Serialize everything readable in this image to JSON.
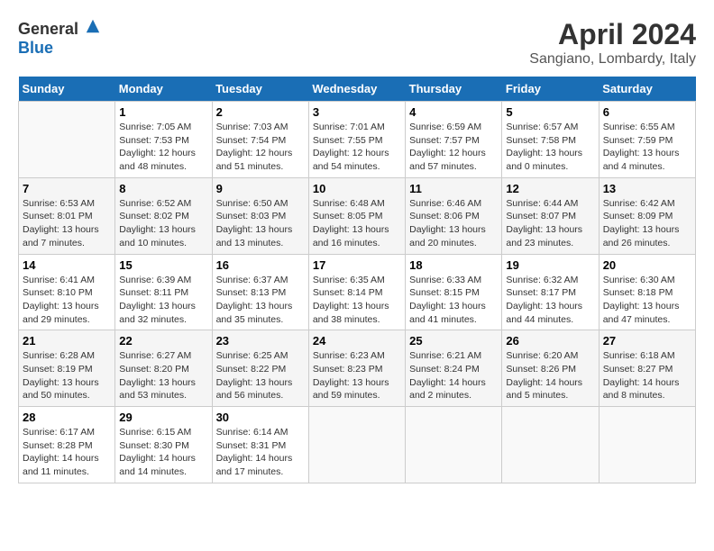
{
  "header": {
    "logo_general": "General",
    "logo_blue": "Blue",
    "month_title": "April 2024",
    "location": "Sangiano, Lombardy, Italy"
  },
  "calendar": {
    "days_of_week": [
      "Sunday",
      "Monday",
      "Tuesday",
      "Wednesday",
      "Thursday",
      "Friday",
      "Saturday"
    ],
    "weeks": [
      [
        {
          "num": "",
          "info": ""
        },
        {
          "num": "1",
          "info": "Sunrise: 7:05 AM\nSunset: 7:53 PM\nDaylight: 12 hours\nand 48 minutes."
        },
        {
          "num": "2",
          "info": "Sunrise: 7:03 AM\nSunset: 7:54 PM\nDaylight: 12 hours\nand 51 minutes."
        },
        {
          "num": "3",
          "info": "Sunrise: 7:01 AM\nSunset: 7:55 PM\nDaylight: 12 hours\nand 54 minutes."
        },
        {
          "num": "4",
          "info": "Sunrise: 6:59 AM\nSunset: 7:57 PM\nDaylight: 12 hours\nand 57 minutes."
        },
        {
          "num": "5",
          "info": "Sunrise: 6:57 AM\nSunset: 7:58 PM\nDaylight: 13 hours\nand 0 minutes."
        },
        {
          "num": "6",
          "info": "Sunrise: 6:55 AM\nSunset: 7:59 PM\nDaylight: 13 hours\nand 4 minutes."
        }
      ],
      [
        {
          "num": "7",
          "info": "Sunrise: 6:53 AM\nSunset: 8:01 PM\nDaylight: 13 hours\nand 7 minutes."
        },
        {
          "num": "8",
          "info": "Sunrise: 6:52 AM\nSunset: 8:02 PM\nDaylight: 13 hours\nand 10 minutes."
        },
        {
          "num": "9",
          "info": "Sunrise: 6:50 AM\nSunset: 8:03 PM\nDaylight: 13 hours\nand 13 minutes."
        },
        {
          "num": "10",
          "info": "Sunrise: 6:48 AM\nSunset: 8:05 PM\nDaylight: 13 hours\nand 16 minutes."
        },
        {
          "num": "11",
          "info": "Sunrise: 6:46 AM\nSunset: 8:06 PM\nDaylight: 13 hours\nand 20 minutes."
        },
        {
          "num": "12",
          "info": "Sunrise: 6:44 AM\nSunset: 8:07 PM\nDaylight: 13 hours\nand 23 minutes."
        },
        {
          "num": "13",
          "info": "Sunrise: 6:42 AM\nSunset: 8:09 PM\nDaylight: 13 hours\nand 26 minutes."
        }
      ],
      [
        {
          "num": "14",
          "info": "Sunrise: 6:41 AM\nSunset: 8:10 PM\nDaylight: 13 hours\nand 29 minutes."
        },
        {
          "num": "15",
          "info": "Sunrise: 6:39 AM\nSunset: 8:11 PM\nDaylight: 13 hours\nand 32 minutes."
        },
        {
          "num": "16",
          "info": "Sunrise: 6:37 AM\nSunset: 8:13 PM\nDaylight: 13 hours\nand 35 minutes."
        },
        {
          "num": "17",
          "info": "Sunrise: 6:35 AM\nSunset: 8:14 PM\nDaylight: 13 hours\nand 38 minutes."
        },
        {
          "num": "18",
          "info": "Sunrise: 6:33 AM\nSunset: 8:15 PM\nDaylight: 13 hours\nand 41 minutes."
        },
        {
          "num": "19",
          "info": "Sunrise: 6:32 AM\nSunset: 8:17 PM\nDaylight: 13 hours\nand 44 minutes."
        },
        {
          "num": "20",
          "info": "Sunrise: 6:30 AM\nSunset: 8:18 PM\nDaylight: 13 hours\nand 47 minutes."
        }
      ],
      [
        {
          "num": "21",
          "info": "Sunrise: 6:28 AM\nSunset: 8:19 PM\nDaylight: 13 hours\nand 50 minutes."
        },
        {
          "num": "22",
          "info": "Sunrise: 6:27 AM\nSunset: 8:20 PM\nDaylight: 13 hours\nand 53 minutes."
        },
        {
          "num": "23",
          "info": "Sunrise: 6:25 AM\nSunset: 8:22 PM\nDaylight: 13 hours\nand 56 minutes."
        },
        {
          "num": "24",
          "info": "Sunrise: 6:23 AM\nSunset: 8:23 PM\nDaylight: 13 hours\nand 59 minutes."
        },
        {
          "num": "25",
          "info": "Sunrise: 6:21 AM\nSunset: 8:24 PM\nDaylight: 14 hours\nand 2 minutes."
        },
        {
          "num": "26",
          "info": "Sunrise: 6:20 AM\nSunset: 8:26 PM\nDaylight: 14 hours\nand 5 minutes."
        },
        {
          "num": "27",
          "info": "Sunrise: 6:18 AM\nSunset: 8:27 PM\nDaylight: 14 hours\nand 8 minutes."
        }
      ],
      [
        {
          "num": "28",
          "info": "Sunrise: 6:17 AM\nSunset: 8:28 PM\nDaylight: 14 hours\nand 11 minutes."
        },
        {
          "num": "29",
          "info": "Sunrise: 6:15 AM\nSunset: 8:30 PM\nDaylight: 14 hours\nand 14 minutes."
        },
        {
          "num": "30",
          "info": "Sunrise: 6:14 AM\nSunset: 8:31 PM\nDaylight: 14 hours\nand 17 minutes."
        },
        {
          "num": "",
          "info": ""
        },
        {
          "num": "",
          "info": ""
        },
        {
          "num": "",
          "info": ""
        },
        {
          "num": "",
          "info": ""
        }
      ]
    ]
  }
}
